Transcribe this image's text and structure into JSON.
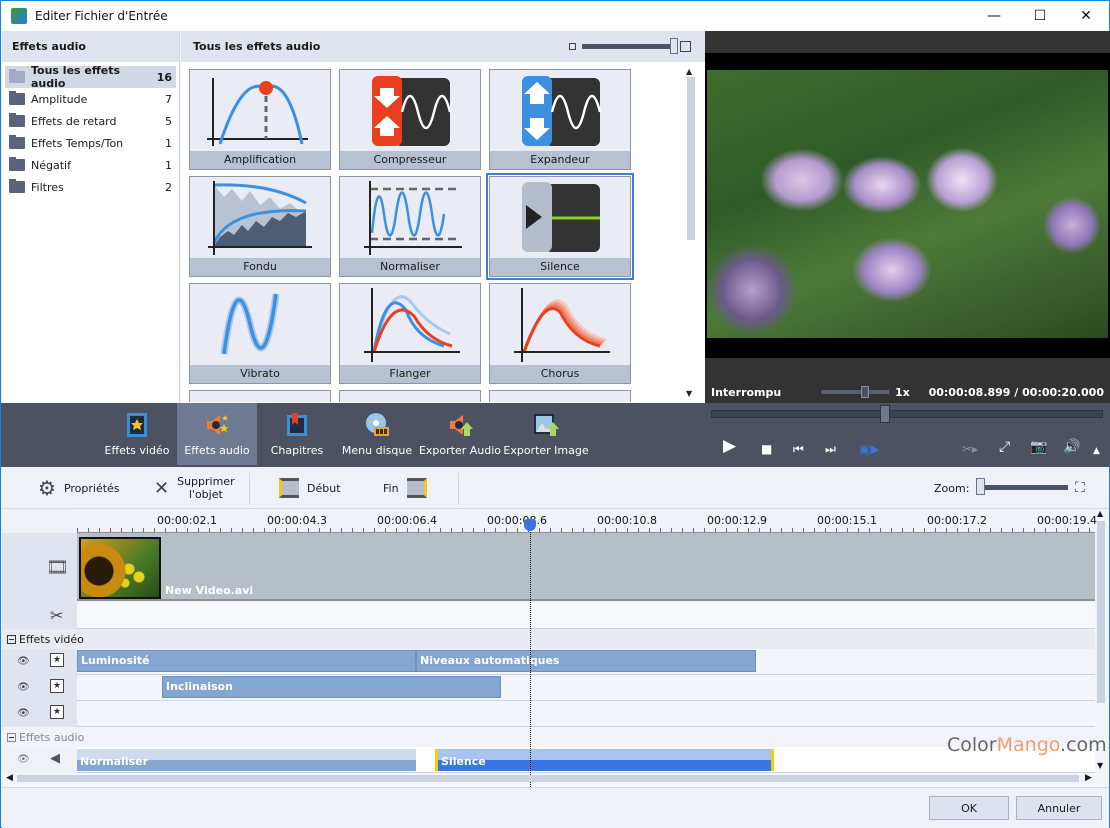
{
  "window": {
    "title": "Editer Fichier d'Entrée",
    "controls": {
      "minimize": "—",
      "maximize": "☐",
      "close": "✕"
    }
  },
  "categories": {
    "header": "Effets audio",
    "items": [
      {
        "label": "Tous les effets audio",
        "count": "16",
        "selected": true
      },
      {
        "label": "Amplitude",
        "count": "7"
      },
      {
        "label": "Effets de retard",
        "count": "5"
      },
      {
        "label": "Effets Temps/Ton",
        "count": "1"
      },
      {
        "label": "Négatif",
        "count": "1"
      },
      {
        "label": "Filtres",
        "count": "2"
      }
    ]
  },
  "effects": {
    "header": "Tous les effets audio",
    "tiles": [
      {
        "label": "Amplification",
        "icon": "amplification-icon"
      },
      {
        "label": "Compresseur",
        "icon": "compressor-icon"
      },
      {
        "label": "Expandeur",
        "icon": "expander-icon"
      },
      {
        "label": "Fondu",
        "icon": "fade-icon"
      },
      {
        "label": "Normaliser",
        "icon": "normalize-icon"
      },
      {
        "label": "Silence",
        "icon": "silence-icon",
        "selected": true
      },
      {
        "label": "Vibrato",
        "icon": "vibrato-icon"
      },
      {
        "label": "Flanger",
        "icon": "flanger-icon"
      },
      {
        "label": "Chorus",
        "icon": "chorus-icon"
      }
    ]
  },
  "preview": {
    "status": "Interrompu",
    "speed": "1x",
    "time": "00:00:08.899 / 00:00:20.000",
    "position_fraction": 0.445
  },
  "tabs": [
    {
      "label": "Effets vidéo",
      "icon": "video-effects-icon"
    },
    {
      "label": "Effets audio",
      "icon": "audio-effects-icon",
      "active": true
    },
    {
      "label": "Chapitres",
      "icon": "chapters-icon"
    },
    {
      "label": "Menu disque",
      "icon": "disc-menu-icon"
    },
    {
      "label": "Exporter Audio",
      "icon": "export-audio-icon"
    },
    {
      "label": "Exporter Image",
      "icon": "export-image-icon"
    }
  ],
  "player_controls": [
    "play",
    "stop",
    "previous-frame",
    "next-frame",
    "play-selection",
    "cut-play",
    "fullscreen",
    "snapshot",
    "volume",
    "more"
  ],
  "toolbar": {
    "properties": "Propriétés",
    "delete_line1": "Supprimer",
    "delete_line2": "l'objet",
    "start": "Début",
    "end": "Fin",
    "zoom_label": "Zoom:"
  },
  "timeline": {
    "ruler_labels": [
      "00:00:02.1",
      "00:00:04.3",
      "00:00:06.4",
      "00:00:08.6",
      "00:00:10.8",
      "00:00:12.9",
      "00:00:15.1",
      "00:00:17.2",
      "00:00:19.4"
    ],
    "video_clip": "New Video.avi",
    "video_effects_group": "Effets vidéo",
    "audio_effects_group": "Effets audio",
    "video_effect_bars": [
      {
        "label": "Luminosité",
        "row": 0
      },
      {
        "label": "Niveaux automatiques",
        "row": 0
      },
      {
        "label": "Inclinaison",
        "row": 1
      }
    ],
    "audio_effect_bars": [
      {
        "label": "Normaliser"
      },
      {
        "label": "Silence",
        "selected": true
      }
    ]
  },
  "watermark": {
    "a": "Color",
    "b": "Mango",
    "c": ".com"
  },
  "footer": {
    "ok": "OK",
    "cancel": "Annuler"
  }
}
